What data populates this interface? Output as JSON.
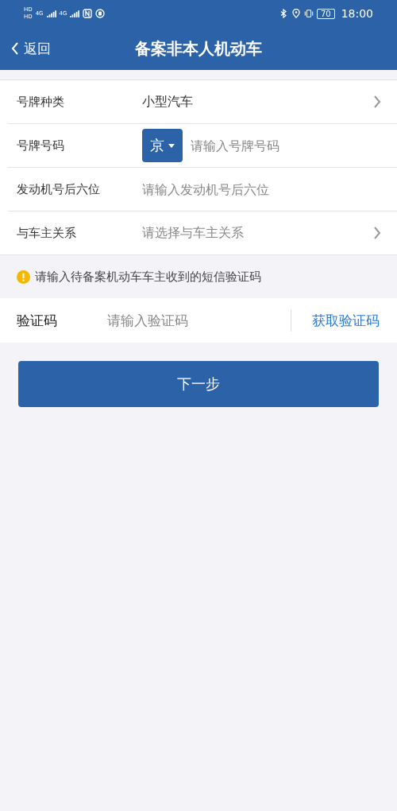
{
  "status_bar": {
    "sim_labels": [
      "HD",
      "HD"
    ],
    "network_labels": [
      "4G",
      "4G"
    ],
    "battery": "70",
    "time": "18:00"
  },
  "nav": {
    "back": "返回",
    "title": "备案非本人机动车"
  },
  "form_rows": [
    {
      "kind": "select",
      "label": "号牌种类",
      "value": "小型汽车"
    },
    {
      "kind": "plate",
      "label": "号牌号码",
      "province": "京",
      "placeholder": "请输入号牌号码"
    },
    {
      "kind": "input",
      "label": "发动机号后六位",
      "placeholder": "请输入发动机号后六位"
    },
    {
      "kind": "select",
      "label": "与车主关系",
      "placeholder": "请选择与车主关系"
    }
  ],
  "notice": "请输入待备案机动车车主收到的短信验证码",
  "code_row": {
    "label": "验证码",
    "placeholder": "请输入验证码",
    "action": "获取验证码"
  },
  "next_button": "下一步"
}
